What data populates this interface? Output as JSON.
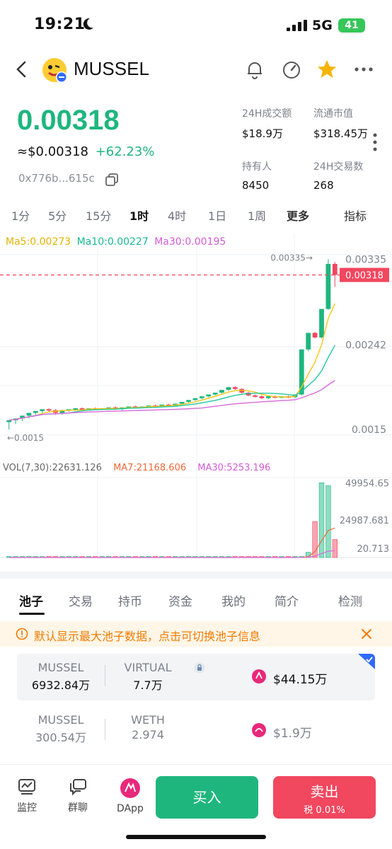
{
  "status": {
    "time": "19:21",
    "network": "5G",
    "battery": "41"
  },
  "header": {
    "token": "MUSSEL"
  },
  "price": {
    "value": "0.00318",
    "usd": "≈$0.00318",
    "change": "+62.23%",
    "address": "0x776b...615c"
  },
  "stats": [
    {
      "label": "24H成交额",
      "value": "$18.9万"
    },
    {
      "label": "流通市值",
      "value": "$318.45万"
    },
    {
      "label": "持有人",
      "value": "8450"
    },
    {
      "label": "24H交易数",
      "value": "268"
    }
  ],
  "timeframes": [
    "1分",
    "5分",
    "15分",
    "1时",
    "4时",
    "1日",
    "1周",
    "更多",
    "指标"
  ],
  "active_timeframe": "1时",
  "ma": {
    "ma5": "Ma5:0.00273",
    "ma10": "Ma10:0.00227",
    "ma30": "Ma30:0.00195"
  },
  "vol": {
    "vol": "VOL(7,30):22631.126",
    "ma7": "MA7:21168.606",
    "ma30": "MA30:5253.196"
  },
  "colors": {
    "up": "#1fb67e",
    "down": "#f1475f",
    "ma5": "#f5c518",
    "ma10": "#21c7a0",
    "ma30": "#d86bdc"
  },
  "chart_data": {
    "type": "candlestick",
    "price_axis_labels": [
      "0.00335",
      "0.00242",
      "0.0015"
    ],
    "current_price_label": "0.00318",
    "high_marker": "0.00335→",
    "low_marker": "←0.0015",
    "volume_axis_labels": [
      "49954.65",
      "24987.681",
      "20.713"
    ],
    "candles": [
      [
        0.00158,
        0.0016,
        0.00152,
        0.0015
      ],
      [
        0.0016,
        0.00162,
        0.00158,
        0.00156
      ],
      [
        0.00162,
        0.00165,
        0.0016,
        0.00159
      ],
      [
        0.00165,
        0.00168,
        0.00163,
        0.00162
      ],
      [
        0.00168,
        0.0017,
        0.00166,
        0.00165
      ],
      [
        0.0017,
        0.00172,
        0.00169,
        0.00168
      ],
      [
        0.00172,
        0.00171,
        0.00169,
        0.00173
      ],
      [
        0.00171,
        0.00168,
        0.00166,
        0.00172
      ],
      [
        0.00168,
        0.00171,
        0.00167,
        0.00166
      ],
      [
        0.00171,
        0.00172,
        0.0017,
        0.00169
      ],
      [
        0.00172,
        0.00173,
        0.00171,
        0.00171
      ],
      [
        0.00173,
        0.00172,
        0.0017,
        0.00174
      ],
      [
        0.00172,
        0.00173,
        0.00171,
        0.00171
      ],
      [
        0.00173,
        0.00172,
        0.00171,
        0.00174
      ],
      [
        0.00172,
        0.00173,
        0.00171,
        0.00171
      ],
      [
        0.00173,
        0.00174,
        0.00172,
        0.00172
      ],
      [
        0.00174,
        0.00172,
        0.00171,
        0.00175
      ],
      [
        0.00172,
        0.00174,
        0.00172,
        0.00171
      ],
      [
        0.00174,
        0.00175,
        0.00173,
        0.00173
      ],
      [
        0.00175,
        0.00174,
        0.00173,
        0.00176
      ],
      [
        0.00174,
        0.00175,
        0.00174,
        0.00173
      ],
      [
        0.00175,
        0.00176,
        0.00174,
        0.00174
      ],
      [
        0.00176,
        0.00175,
        0.00174,
        0.00177
      ],
      [
        0.00175,
        0.00177,
        0.00176,
        0.00174
      ],
      [
        0.00177,
        0.00176,
        0.00175,
        0.00178
      ],
      [
        0.00176,
        0.00178,
        0.00177,
        0.00175
      ],
      [
        0.00178,
        0.0018,
        0.00179,
        0.00177
      ],
      [
        0.0018,
        0.00182,
        0.00181,
        0.00179
      ],
      [
        0.00182,
        0.00184,
        0.00183,
        0.00181
      ],
      [
        0.00184,
        0.00186,
        0.00185,
        0.00183
      ],
      [
        0.00186,
        0.00188,
        0.00187,
        0.00185
      ],
      [
        0.00188,
        0.0019,
        0.00189,
        0.00187
      ],
      [
        0.0019,
        0.00193,
        0.00192,
        0.00189
      ],
      [
        0.00193,
        0.00196,
        0.00195,
        0.00192
      ],
      [
        0.00196,
        0.00194,
        0.00193,
        0.00197
      ],
      [
        0.00194,
        0.0019,
        0.00189,
        0.00195
      ],
      [
        0.0019,
        0.00187,
        0.00186,
        0.00191
      ],
      [
        0.00187,
        0.00186,
        0.00185,
        0.00188
      ],
      [
        0.00186,
        0.00184,
        0.00183,
        0.00187
      ],
      [
        0.00184,
        0.00186,
        0.00183,
        0.00183
      ],
      [
        0.00186,
        0.00185,
        0.00184,
        0.00187
      ],
      [
        0.00185,
        0.00186,
        0.00184,
        0.00184
      ],
      [
        0.00186,
        0.00185,
        0.00184,
        0.00187
      ],
      [
        0.00185,
        0.00188,
        0.00187,
        0.00184
      ],
      [
        0.00188,
        0.00237,
        0.00236,
        0.00187
      ],
      [
        0.00237,
        0.00255,
        0.00254,
        0.00235
      ],
      [
        0.00255,
        0.0025,
        0.00249,
        0.00256
      ],
      [
        0.0025,
        0.00281,
        0.0028,
        0.00249
      ],
      [
        0.00281,
        0.0033,
        0.00335,
        0.0028
      ],
      [
        0.0033,
        0.00318,
        0.00305,
        0.00332
      ]
    ],
    "volumes": [
      0,
      0,
      0,
      0,
      0,
      0,
      0,
      0,
      0,
      0,
      0,
      0,
      0,
      0,
      0,
      0,
      0,
      0,
      0,
      0,
      0,
      0,
      0,
      0,
      0,
      0,
      0,
      0,
      0,
      0,
      0,
      0,
      0,
      0,
      0,
      0,
      0,
      0,
      0,
      0,
      0,
      0,
      0,
      0,
      600,
      3500,
      24000,
      49954,
      48000,
      12000
    ]
  },
  "tabs": [
    "池子",
    "交易",
    "持币",
    "资金",
    "我的",
    "简介",
    "检测"
  ],
  "notice": "默认显示最大池子数据，点击可切换池子信息",
  "pools": [
    {
      "t1": "MUSSEL",
      "v1": "6932.84万",
      "t2": "VIRTUAL",
      "v2": "7.7万",
      "liquidity": "$44.15万"
    },
    {
      "t1": "MUSSEL",
      "v1": "300.54万",
      "t2": "WETH",
      "v2": "2.974",
      "liquidity": "$1.9万"
    }
  ],
  "bottom": {
    "monitor": "监控",
    "chat": "群聊",
    "dapp": "DApp",
    "buy": "买入",
    "sell": "卖出",
    "tax": "税 0.01%"
  }
}
